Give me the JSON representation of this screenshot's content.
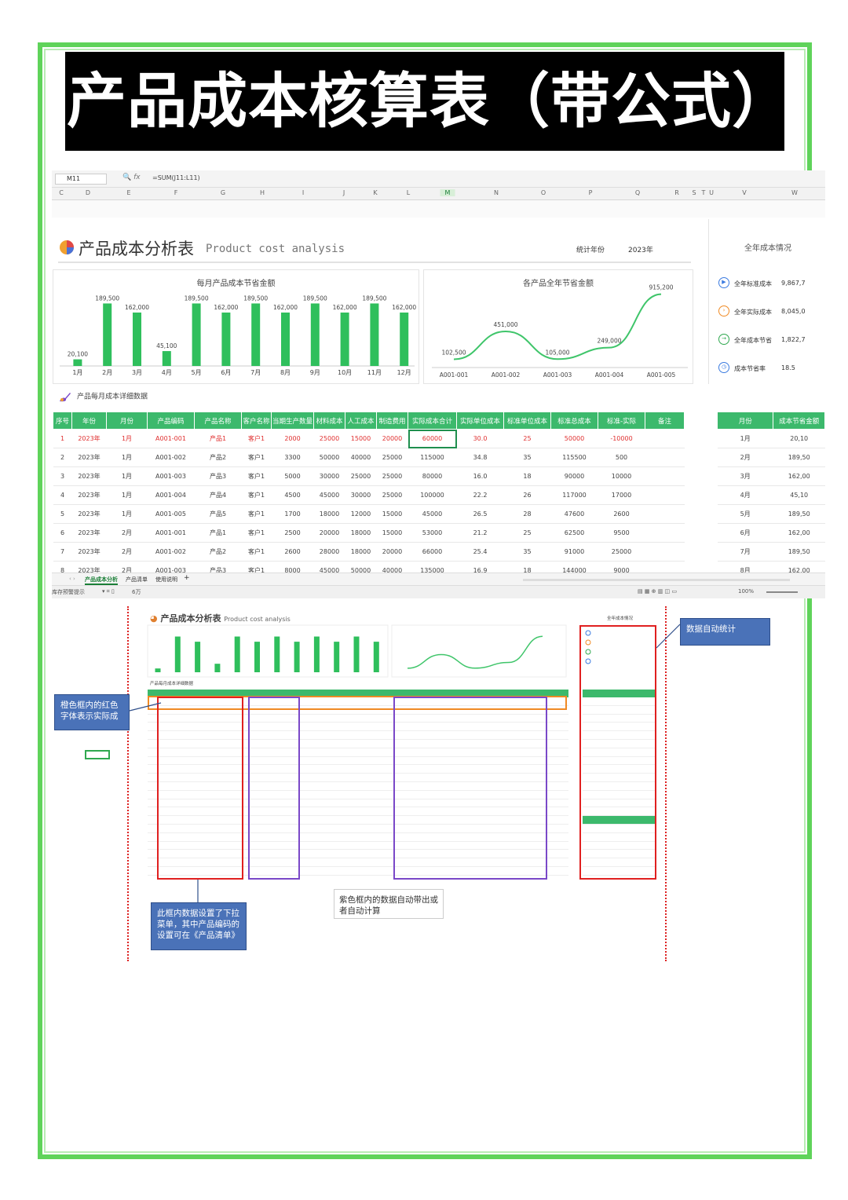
{
  "title": "产品成本核算表（带公式）",
  "colors": {
    "frame": "#5fd35a",
    "header_green": "#3cb96c",
    "bar_green": "#2fbf5c",
    "red_text": "#e03030",
    "note_blue": "#4a72b8"
  },
  "sheet": {
    "name_box": "M11",
    "fx_label": "fx",
    "formula": "=SUM(J11:L11)",
    "columns": [
      "C",
      "D",
      "E",
      "F",
      "G",
      "H",
      "I",
      "J",
      "K",
      "L",
      "M",
      "N",
      "O",
      "P",
      "Q",
      "R",
      "S",
      "T",
      "U",
      "V",
      "W"
    ],
    "active_column": "M",
    "analysis_title": "产品成本分析表",
    "analysis_title_en": "Product cost analysis",
    "year_label": "统计年份",
    "year_value": "2023年",
    "monthly_chart_title": "每月产品成本节省金额",
    "product_chart_title": "各产品全年节省金额",
    "summary": {
      "title": "全年成本情况",
      "items": [
        {
          "label": "全年标准成本",
          "value": "9,867,7",
          "icon": "play-circle-icon",
          "color": "#3b7be0"
        },
        {
          "label": "全年实际成本",
          "value": "8,045,0",
          "icon": "chevron-circle-icon",
          "color": "#f08a24"
        },
        {
          "label": "全年成本节省",
          "value": "1,822,7",
          "icon": "arrow-circle-icon",
          "color": "#2fa84f"
        },
        {
          "label": "成本节省率",
          "value": "18.5",
          "icon": "clock-icon",
          "color": "#3b7be0"
        }
      ]
    },
    "detail_caption": "产品每月成本详细数据",
    "detail_headers": [
      "序号",
      "年份",
      "月份",
      "产品编码",
      "产品名称",
      "客户名称",
      "当期生产数量",
      "材料成本",
      "人工成本",
      "制造费用",
      "实际成本合计",
      "实际单位成本",
      "标准单位成本",
      "标准总成本",
      "标准-实际",
      "备注"
    ],
    "detail_rows": [
      [
        "1",
        "2023年",
        "1月",
        "A001-001",
        "产品1",
        "客户1",
        "2000",
        "25000",
        "15000",
        "20000",
        "60000",
        "30.0",
        "25",
        "50000",
        "-10000",
        ""
      ],
      [
        "2",
        "2023年",
        "1月",
        "A001-002",
        "产品2",
        "客户1",
        "3300",
        "50000",
        "40000",
        "25000",
        "115000",
        "34.8",
        "35",
        "115500",
        "500",
        ""
      ],
      [
        "3",
        "2023年",
        "1月",
        "A001-003",
        "产品3",
        "客户1",
        "5000",
        "30000",
        "25000",
        "25000",
        "80000",
        "16.0",
        "18",
        "90000",
        "10000",
        ""
      ],
      [
        "4",
        "2023年",
        "1月",
        "A001-004",
        "产品4",
        "客户1",
        "4500",
        "45000",
        "30000",
        "25000",
        "100000",
        "22.2",
        "26",
        "117000",
        "17000",
        ""
      ],
      [
        "5",
        "2023年",
        "1月",
        "A001-005",
        "产品5",
        "客户1",
        "1700",
        "18000",
        "12000",
        "15000",
        "45000",
        "26.5",
        "28",
        "47600",
        "2600",
        ""
      ],
      [
        "6",
        "2023年",
        "2月",
        "A001-001",
        "产品1",
        "客户1",
        "2500",
        "20000",
        "18000",
        "15000",
        "53000",
        "21.2",
        "25",
        "62500",
        "9500",
        ""
      ],
      [
        "7",
        "2023年",
        "2月",
        "A001-002",
        "产品2",
        "客户1",
        "2600",
        "28000",
        "18000",
        "20000",
        "66000",
        "25.4",
        "35",
        "91000",
        "25000",
        ""
      ],
      [
        "8",
        "2023年",
        "2月",
        "A001-003",
        "产品3",
        "客户1",
        "8000",
        "45000",
        "50000",
        "40000",
        "135000",
        "16.9",
        "18",
        "144000",
        "9000",
        ""
      ]
    ],
    "side_headers": [
      "月份",
      "成本节省金额"
    ],
    "side_rows": [
      [
        "1月",
        "20,10"
      ],
      [
        "2月",
        "189,50"
      ],
      [
        "3月",
        "162,00"
      ],
      [
        "4月",
        "45,10"
      ],
      [
        "5月",
        "189,50"
      ],
      [
        "6月",
        "162,00"
      ],
      [
        "7月",
        "189,50"
      ],
      [
        "8月",
        "162,00"
      ]
    ],
    "tabs": [
      "产品成本分析",
      "产品清单",
      "使用说明",
      "+"
    ],
    "status_left": "库存预警提示",
    "status_zoom": "100%",
    "status_count": "6万"
  },
  "chart_data": [
    {
      "type": "bar",
      "title": "每月产品成本节省金额",
      "categories": [
        "1月",
        "2月",
        "3月",
        "4月",
        "5月",
        "6月",
        "7月",
        "8月",
        "9月",
        "10月",
        "11月",
        "12月"
      ],
      "values": [
        20100,
        189500,
        162000,
        45100,
        189500,
        162000,
        189500,
        162000,
        189500,
        162000,
        189500,
        162000
      ],
      "labels": [
        "20,100",
        "189,500",
        "162,000",
        "45,100",
        "189,500",
        "162,000",
        "189,500",
        "162,000",
        "189,500",
        "162,000",
        "189,500",
        "162,000"
      ],
      "ylim": [
        0,
        200000
      ]
    },
    {
      "type": "line",
      "title": "各产品全年节省金额",
      "categories": [
        "A001-001",
        "A001-002",
        "A001-003",
        "A001-004",
        "A001-005"
      ],
      "values": [
        102500,
        451000,
        105000,
        249000,
        915200
      ],
      "labels": [
        "102,500",
        "451,000",
        "105,000",
        "249,000",
        "915,200"
      ],
      "ylim": [
        0,
        1000000
      ]
    }
  ],
  "annotations": {
    "orange_note": "橙色框内的红色字体表示实际成",
    "auto_stat_note": "数据自动统计",
    "dropdown_note": "此框内数据设置了下拉菜单，其中产品编码的设置可在《产品清单》",
    "purple_note": "紫色框内的数据自动带出或者自动计算"
  },
  "mini": {
    "title": "产品成本分析表",
    "title_en": "Product cost analysis",
    "detail_caption": "产品每月成本详细数据",
    "summary_title": "全年成本情况"
  }
}
